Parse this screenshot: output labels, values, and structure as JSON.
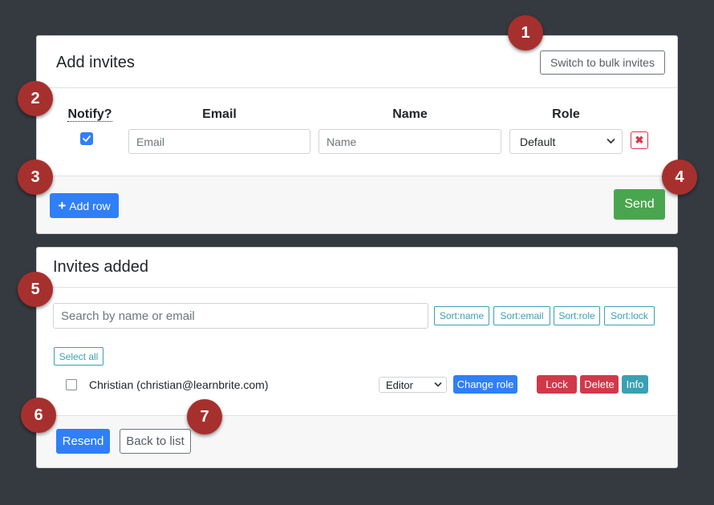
{
  "add_invites": {
    "title": "Add invites",
    "switch_bulk_label": "Switch to bulk invites",
    "columns": {
      "notify": "Notify?",
      "email": "Email",
      "name": "Name",
      "role": "Role"
    },
    "row": {
      "notify_checked": true,
      "email_placeholder": "Email",
      "name_placeholder": "Name",
      "role_value": "Default",
      "remove_symbol": "✖"
    },
    "add_row_label": "Add row",
    "add_row_symbol": "+",
    "send_label": "Send"
  },
  "invites_added": {
    "title": "Invites added",
    "search_placeholder": "Search by name or email",
    "sort_buttons": [
      "Sort:name",
      "Sort:email",
      "Sort:role",
      "Sort:lock"
    ],
    "select_all_label": "Select all",
    "users": [
      {
        "label": "Christian (christian@learnbrite.com)",
        "checked": false,
        "role": "Editor",
        "change_role_label": "Change role",
        "lock_label": "Lock",
        "delete_label": "Delete",
        "info_label": "Info"
      }
    ],
    "resend_label": "Resend",
    "back_label": "Back to list"
  },
  "markers": [
    "1",
    "2",
    "3",
    "4",
    "5",
    "6",
    "7"
  ],
  "colors": {
    "background": "#343a40",
    "primary": "#2f7ff7",
    "success": "#4aa64e",
    "danger": "#d1394a",
    "info": "#3aa0b3",
    "marker": "#a6302e"
  }
}
